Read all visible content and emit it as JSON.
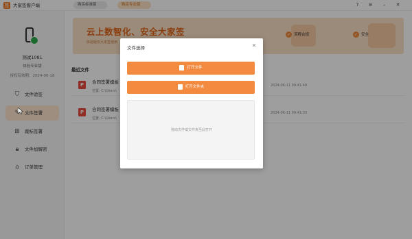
{
  "titlebar": {
    "app_name": "大家签客户端",
    "btn_standard": "购买标准版",
    "btn_pro": "购买专业版",
    "logo_text": "签"
  },
  "sidebar": {
    "user_name": "测试1081",
    "user_tier": "体验专业版",
    "expiry": "授权有效期：2024-06-18",
    "items": [
      {
        "label": "文件验签",
        "icon": "shield-check-icon"
      },
      {
        "label": "文件签署",
        "icon": "pen-icon"
      },
      {
        "label": "裁标签署",
        "icon": "stamp-icon"
      },
      {
        "label": "文件加解密",
        "icon": "lock-icon"
      },
      {
        "label": "订单管理",
        "icon": "cart-icon"
      }
    ]
  },
  "banner": {
    "title": "云上数智化、安全大家签",
    "subtitle": "体验版仅大家签使用",
    "feature1": "流程合规",
    "feature2": "安全"
  },
  "recent": {
    "title": "最近文件",
    "files": [
      {
        "name": "合同签署模板",
        "path": "位置:  C:\\Users\\",
        "date": "2024-06-11 09:41:49",
        "icon": "pdf-icon"
      },
      {
        "name": "合同签署模板",
        "path": "位置:  C:\\Users\\",
        "date": "2024-06-11 09:41:33",
        "icon": "pdf-icon"
      }
    ]
  },
  "modal": {
    "title": "文件选择",
    "open_file": "打开文件",
    "open_folder": "打开文件夹",
    "drop_hint": "拖动文件或文件夹至此打开"
  },
  "colors": {
    "accent": "#f28a40",
    "banner_bg": "#fbe0c6",
    "active_nav": "#fde6cf"
  }
}
